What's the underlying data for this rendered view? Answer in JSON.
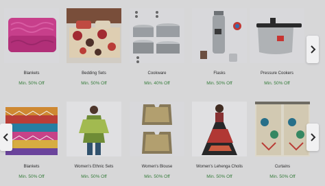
{
  "row1": [
    {
      "name": "Blankets",
      "offer": "Min. 50% Off"
    },
    {
      "name": "Bedding Sets",
      "offer": "Min. 50% Off"
    },
    {
      "name": "Cookware",
      "offer": "Min. 40% Off"
    },
    {
      "name": "Flasks",
      "offer": "Min. 50% Off"
    },
    {
      "name": "Pressure Cookers",
      "offer": "Min. 50% Off"
    }
  ],
  "row2": [
    {
      "name": "Blankets",
      "offer": "Min. 50% Off"
    },
    {
      "name": "Women's Ethnic Sets",
      "offer": "Min. 50% Off"
    },
    {
      "name": "Women's Blouse",
      "offer": "Min. 50% Off"
    },
    {
      "name": "Women's Lehenga Cholis",
      "offer": "Min. 50% Off"
    },
    {
      "name": "Curtains",
      "offer": "Min. 50% Off"
    }
  ],
  "icons": {
    "next": "chevron-right-icon",
    "prev": "chevron-left-icon"
  },
  "colors": {
    "offer": "#2e7d32",
    "background": "#e2e2e3"
  }
}
